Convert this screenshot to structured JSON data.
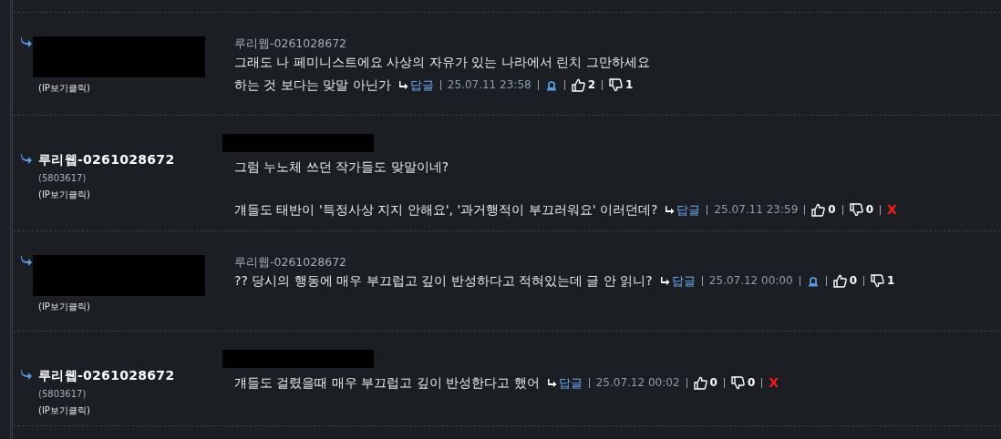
{
  "comments": [
    {
      "kind": "other",
      "ip_label": "(IP보기클릭)",
      "mention": "루리웹-0261028672",
      "paragraphs": [
        [
          "그래도 나 페미니스트에요 사상의 자유가 있는 나라에서 린치 그만하세요",
          "하는 것 보다는 맞말 아닌가"
        ]
      ],
      "reply_label": "답글",
      "date": "25.07.11 23:58",
      "likes": "2",
      "dislikes": "1"
    },
    {
      "kind": "own",
      "name": "루리웹-0261028672",
      "user_id": "(5803617)",
      "ip_label": "(IP보기클릭)",
      "paragraphs": [
        [
          "그럼 누노체 쓰던 작가들도 맞말이네?"
        ],
        [
          "걔들도 태반이 '특정사상 지지 안해요', '과거행적이 부끄러워요' 이러던데?"
        ]
      ],
      "reply_label": "답글",
      "date": "25.07.11 23:59",
      "likes": "0",
      "dislikes": "0",
      "delete_label": "X"
    },
    {
      "kind": "other",
      "ip_label": "(IP보기클릭)",
      "mention": "루리웹-0261028672",
      "paragraphs": [
        [
          "?? 당시의 행동에 매우 부끄럽고 깊이 반성하다고 적혀있는데 글 안 읽니?"
        ]
      ],
      "reply_label": "답글",
      "date": "25.07.12 00:00",
      "likes": "0",
      "dislikes": "1"
    },
    {
      "kind": "own",
      "name": "루리웹-0261028672",
      "user_id": "(5803617)",
      "ip_label": "(IP보기클릭)",
      "paragraphs": [
        [
          "걔들도 걸렸을때 매우 부끄럽고 깊이 반성한다고 했어"
        ]
      ],
      "reply_label": "답글",
      "date": "25.07.12 00:02",
      "likes": "0",
      "dislikes": "0",
      "delete_label": "X"
    }
  ]
}
